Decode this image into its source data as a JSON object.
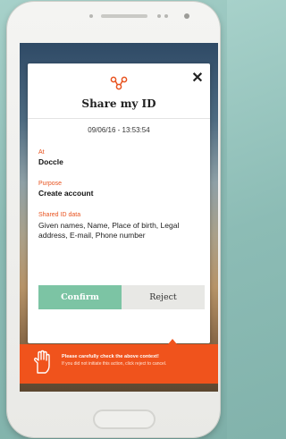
{
  "dialog": {
    "title": "Share my ID",
    "timestamp": "09/06/16 - 13:53:54",
    "at_label": "At",
    "at_value": "Doccle",
    "purpose_label": "Purpose",
    "purpose_value": "Create account",
    "shared_label": "Shared ID data",
    "shared_value": "Given names, Name, Place of birth, Legal address, E-mail, Phone number",
    "close_icon": "close-icon",
    "header_icon": "share-network-icon"
  },
  "actions": {
    "confirm_label": "Confirm",
    "reject_label": "Reject"
  },
  "warning": {
    "title": "Please carefully check the above context!",
    "text": "If you did not initiate this action, click reject to cancel.",
    "icon": "hand-icon"
  },
  "colors": {
    "accent": "#e8531f",
    "confirm": "#7cc4a4",
    "warning_bg": "#f0531c"
  }
}
